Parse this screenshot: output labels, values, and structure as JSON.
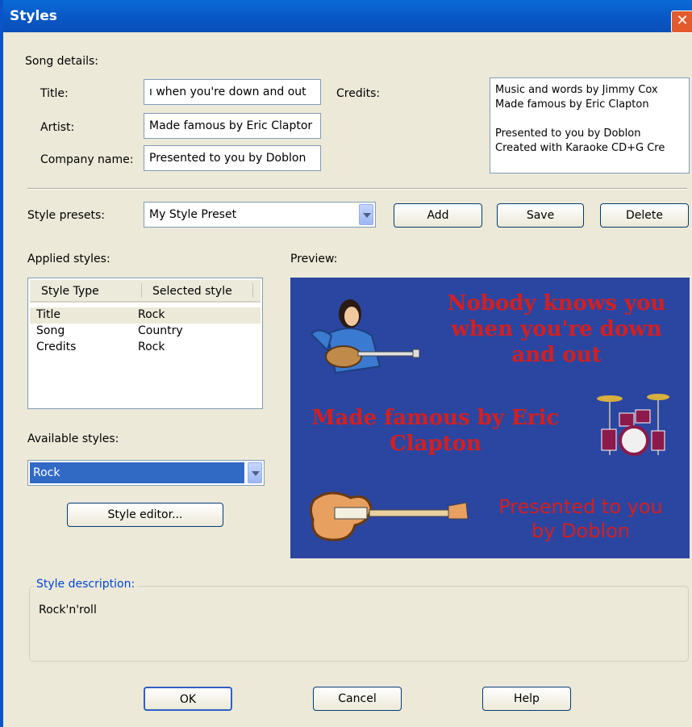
{
  "window": {
    "title": "Styles"
  },
  "song_details": {
    "heading": "Song details:",
    "title_label": "Title:",
    "title_value": "ı when you're down and out",
    "artist_label": "Artist:",
    "artist_value": "Made famous by Eric Claptor",
    "company_label": "Company name:",
    "company_value": "Presented to you by Doblon",
    "credits_label": "Credits:",
    "credits_value": "Music and words by Jimmy Cox\nMade famous by Eric Clapton\n\nPresented to you by Doblon\nCreated with Karaoke CD+G Cre"
  },
  "presets": {
    "label": "Style presets:",
    "selected": "My Style Preset",
    "add_label": "Add",
    "save_label": "Save",
    "delete_label": "Delete"
  },
  "applied": {
    "label": "Applied styles:",
    "columns": [
      "Style Type",
      "Selected style"
    ],
    "rows": [
      {
        "type": "Title",
        "style": "Rock"
      },
      {
        "type": "Song",
        "style": "Country"
      },
      {
        "type": "Credits",
        "style": "Rock"
      }
    ]
  },
  "available": {
    "label": "Available styles:",
    "selected": "Rock",
    "editor_label": "Style editor..."
  },
  "preview": {
    "label": "Preview:",
    "title_text": "Nobody knows you\nwhen you're down\nand out",
    "artist_text": "Made famous by Eric\nClapton",
    "company_text": "Presented to you\nby Doblon"
  },
  "description": {
    "label": "Style description:",
    "text": "Rock'n'roll"
  },
  "buttons": {
    "ok": "OK",
    "cancel": "Cancel",
    "help": "Help"
  },
  "colors": {
    "preview_bg": "#2b46a0",
    "preview_text": "#d41f1f",
    "selection": "#316ac5"
  }
}
